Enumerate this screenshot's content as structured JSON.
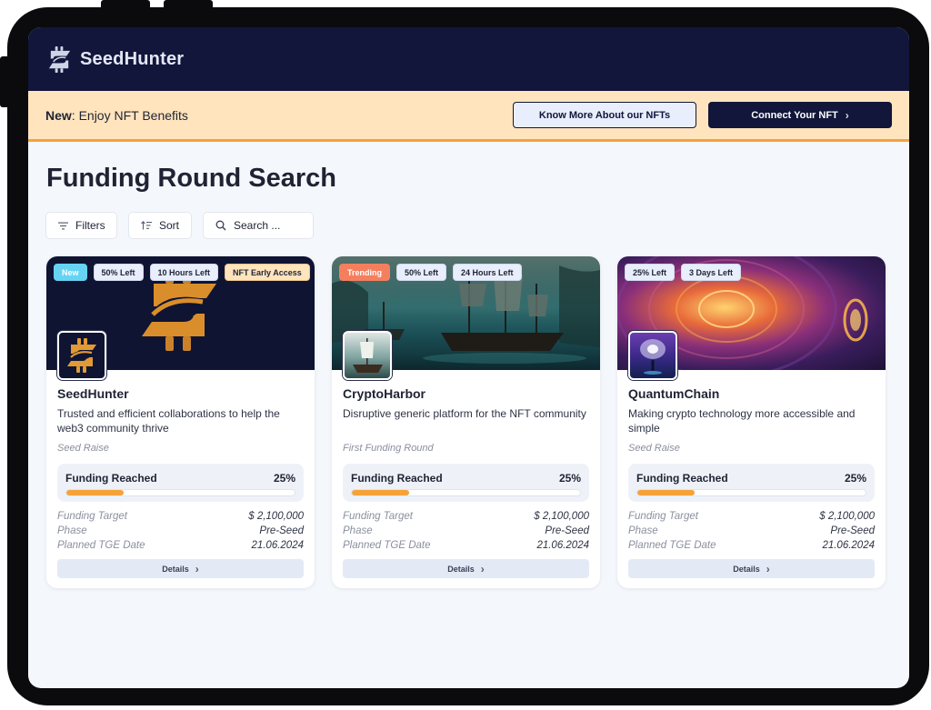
{
  "app": {
    "name": "SeedHunter"
  },
  "banner": {
    "prefix": "New",
    "text": ": Enjoy NFT Benefits",
    "know_more_label": "Know More About our NFTs",
    "connect_label": "Connect Your NFT"
  },
  "page": {
    "title": "Funding Round Search"
  },
  "toolbar": {
    "filters_label": "Filters",
    "sort_label": "Sort",
    "search_placeholder": "Search ..."
  },
  "colors": {
    "navy": "#11163a",
    "accent_orange": "#f5a23a",
    "banner_bg": "#ffe4bd",
    "badge_new": "#66d3f3",
    "badge_trending": "#f47f5e"
  },
  "cards": [
    {
      "name": "SeedHunter",
      "description": "Trusted and efficient collaborations to help the web3 community thrive",
      "round": "Seed Raise",
      "badges": [
        "New",
        "50% Left",
        "10 Hours Left",
        "NFT Early Access"
      ],
      "funding_label": "Funding Reached",
      "funding_percent_label": "25%",
      "funding_fraction": 0.25,
      "meta": [
        {
          "label": "Funding Target",
          "value": "$ 2,100,000"
        },
        {
          "label": "Phase",
          "value": "Pre-Seed"
        },
        {
          "label": "Planned TGE Date",
          "value": "21.06.2024"
        }
      ],
      "details_label": "Details"
    },
    {
      "name": "CryptoHarbor",
      "description": "Disruptive generic platform for the NFT community",
      "round": "First Funding Round",
      "badges": [
        "Trending",
        "50% Left",
        "24 Hours Left"
      ],
      "funding_label": "Funding Reached",
      "funding_percent_label": "25%",
      "funding_fraction": 0.25,
      "meta": [
        {
          "label": "Funding Target",
          "value": "$ 2,100,000"
        },
        {
          "label": "Phase",
          "value": "Pre-Seed"
        },
        {
          "label": "Planned TGE Date",
          "value": "21.06.2024"
        }
      ],
      "details_label": "Details"
    },
    {
      "name": "QuantumChain",
      "description": "Making crypto technology more accessible and simple",
      "round": "Seed Raise",
      "badges": [
        "25% Left",
        "3 Days Left"
      ],
      "funding_label": "Funding Reached",
      "funding_percent_label": "25%",
      "funding_fraction": 0.25,
      "meta": [
        {
          "label": "Funding Target",
          "value": "$ 2,100,000"
        },
        {
          "label": "Phase",
          "value": "Pre-Seed"
        },
        {
          "label": "Planned TGE Date",
          "value": "21.06.2024"
        }
      ],
      "details_label": "Details"
    }
  ]
}
